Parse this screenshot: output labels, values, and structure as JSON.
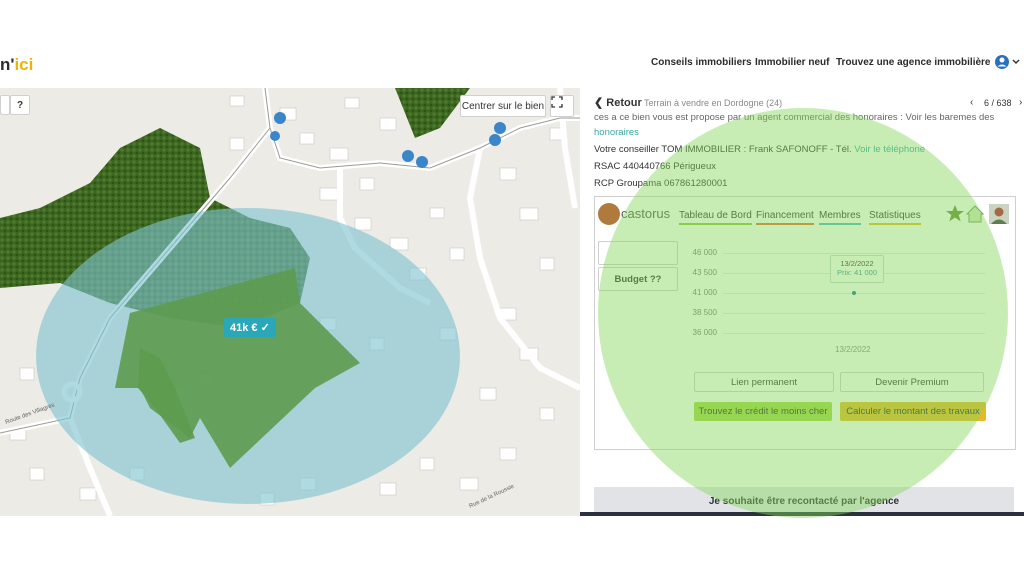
{
  "header": {
    "logo_main": "n'",
    "logo_accent": "ici",
    "nav": [
      {
        "label": "Conseils immobiliers"
      },
      {
        "label": "Immobilier neuf"
      },
      {
        "label": "Trouvez une agence immobilière"
      }
    ],
    "user_icon": "user-circle-icon",
    "chevron_icon": "chevron-down-icon"
  },
  "map": {
    "help_label": "?",
    "center_label": "Centrer sur le bien",
    "fullscreen_icon": "fullscreen-icon",
    "price_tag": "41k €",
    "road_label": "Route des Villagres",
    "road_label2": "Rue de la Roussie",
    "colors": {
      "zone": "#7ec4cf",
      "forest": "#3f6b22",
      "field": "#5d9b4f"
    }
  },
  "panel": {
    "back_label": "Retour",
    "listing_title": "Terrain à vendre en Dordogne (24)",
    "pagination": "6 / 638",
    "partial_line": "ces a ce bien vous est propose par un agent commercial des honoraires : Voir les baremes des",
    "honoraires_link": "honoraires",
    "advisor_prefix": "Votre conseiller TOM IMMOBILIER : Frank SAFONOFF - Tél.",
    "phone_link": "Voir le téléphone",
    "rsac": "RSAC 440440766 Périgueux",
    "rcp": "RCP Groupama 067861280001"
  },
  "widget": {
    "brand": "castorus",
    "tabs": [
      {
        "label": "Tableau de Bord",
        "color": "#8cc63f"
      },
      {
        "label": "Financement",
        "color": "#e86a2c"
      },
      {
        "label": "Membres",
        "color": "#4fb8c7"
      },
      {
        "label": "Statistiques",
        "color": "#e8b91c"
      }
    ],
    "budget_label": "Budget ??",
    "buttons": {
      "permalink": "Lien permanent",
      "premium": "Devenir Premium",
      "credit": "Trouvez le crédit le moins cher",
      "works": "Calculer le montant des travaux"
    },
    "colors": {
      "credit": "#a6d64a",
      "works": "#e7b92a"
    }
  },
  "chart_data": {
    "type": "scatter",
    "title": "",
    "xlabel": "",
    "ylabel": "",
    "yticks": [
      "46 000",
      "43 500",
      "41 000",
      "38 500",
      "36 000"
    ],
    "ylim": [
      36000,
      46000
    ],
    "xticks": [
      "13/2/2022"
    ],
    "points": [
      {
        "x": "13/2/2022",
        "y": 41000
      }
    ],
    "tooltip": {
      "date": "13/2/2022",
      "text": "Prix: 41 000"
    },
    "grid": true
  },
  "contact": {
    "label": "Je souhaite être recontacté par l'agence"
  }
}
